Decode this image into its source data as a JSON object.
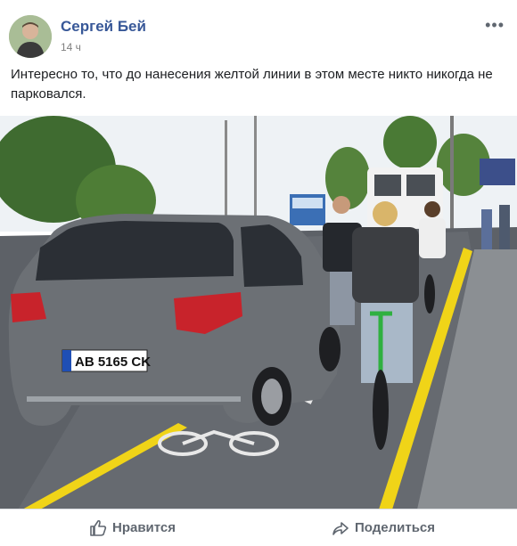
{
  "post": {
    "author": "Сергей Бей",
    "time": "14 ч",
    "more": "•••",
    "text": "Интересно то, что до нанесения желтой линии в этом месте никто никогда не парковался."
  },
  "photo": {
    "plate": "AB 5165 CK",
    "sign_text": ""
  },
  "actions": {
    "like_label": "Нравится",
    "share_label": "Поделиться"
  },
  "icons": {
    "like": "thumbs-up-icon",
    "share": "share-arrow-icon"
  },
  "colors": {
    "author": "#385898",
    "action_text": "#606770",
    "car": "#6c7075",
    "lane_line": "#f0d418",
    "bike": "#2fb040"
  }
}
